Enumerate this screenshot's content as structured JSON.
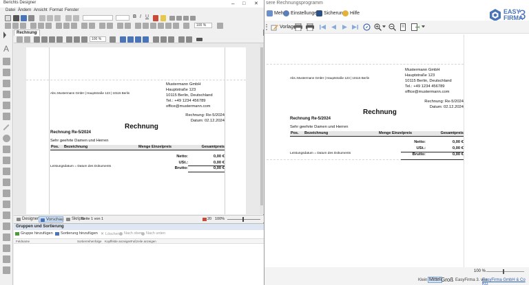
{
  "right_app": {
    "title": "sere Rechnungsprogramm",
    "menu": [
      {
        "label": "Mehr",
        "icon": "more-icon"
      },
      {
        "label": "Einstellungen",
        "icon": "settings-icon"
      },
      {
        "label": "Sicherung",
        "icon": "backup-icon"
      },
      {
        "label": "Hilfe",
        "icon": "help-icon"
      }
    ],
    "logo": {
      "line1": "EASY",
      "line2": "FIRMA",
      "number": "3"
    },
    "toolbar": {
      "template_label": "Vorlage"
    },
    "status": {
      "zoom": "100 %",
      "size_small": "Klein",
      "size_medium": "Mittel",
      "size_large": "Groß",
      "footer": "EasyFirma 3. von",
      "footer_link": "EasyFirma GmbH & Co KG"
    },
    "accent": "#4a74b8"
  },
  "designer": {
    "title": "Berichts Designer",
    "window_controls": {
      "minimize": "–",
      "maximize": "□",
      "close": "✕"
    },
    "menu": [
      "Datei",
      "Ändern",
      "Ansicht",
      "Format",
      "Fenster"
    ],
    "zoom_combo_top": "100 %",
    "doc_tab": "Rechnung",
    "doc_tab_close": "✕",
    "zoom_combo": "100 %",
    "tabs": {
      "designer": "Designer",
      "preview": "Vorschau",
      "scripts": "Skripte",
      "page": "Seite 1 von 1"
    },
    "status": {
      "count": "20",
      "zoom": "100%"
    },
    "groups": {
      "header": "Gruppen und Sortierung",
      "actions": {
        "add_group": "Gruppe hinzufügen",
        "add_sort": "Sortierung hinzufügen",
        "delete": "Löschen",
        "up": "Nach oben",
        "down": "Nach unten"
      },
      "columns": [
        "Feldname",
        "Sortierreihenfolge",
        "Kopffelde anzeigen",
        "Fußzeile anzeigen"
      ]
    }
  },
  "invoice": {
    "sender_line": "Abs.:Mustermann GmbH | Hauptstraße 123 | 10115 Berlin",
    "company": {
      "name": "Mustermann GmbH",
      "street": "Hauptstraße 123",
      "city": "10115 Berlin, Deutschland",
      "phone": "Tel.: +49 1234 456789",
      "email": "office@mustermann.com"
    },
    "invoice_no_line": "Rechnung: Re-5/2024",
    "date_line": "Datum: 02.12.2024",
    "title": "Rechnung",
    "subject": "Rechnung Re-5/2024",
    "greeting": "Sehr geehrte Damen und Herren",
    "columns": {
      "pos": "Pos.",
      "desc": "Bezeichnung",
      "qty": "Menge",
      "unit": "Einzelpreis",
      "total": "Gesamtpreis"
    },
    "service_date": "Leistungsdatum = Datum des Dokuments",
    "totals": [
      {
        "label": "Netto:",
        "value": "0,00 €"
      },
      {
        "label": "USt.:",
        "value": "0,00 €"
      },
      {
        "label": "Brutto:",
        "value": "0,00 €"
      }
    ]
  }
}
